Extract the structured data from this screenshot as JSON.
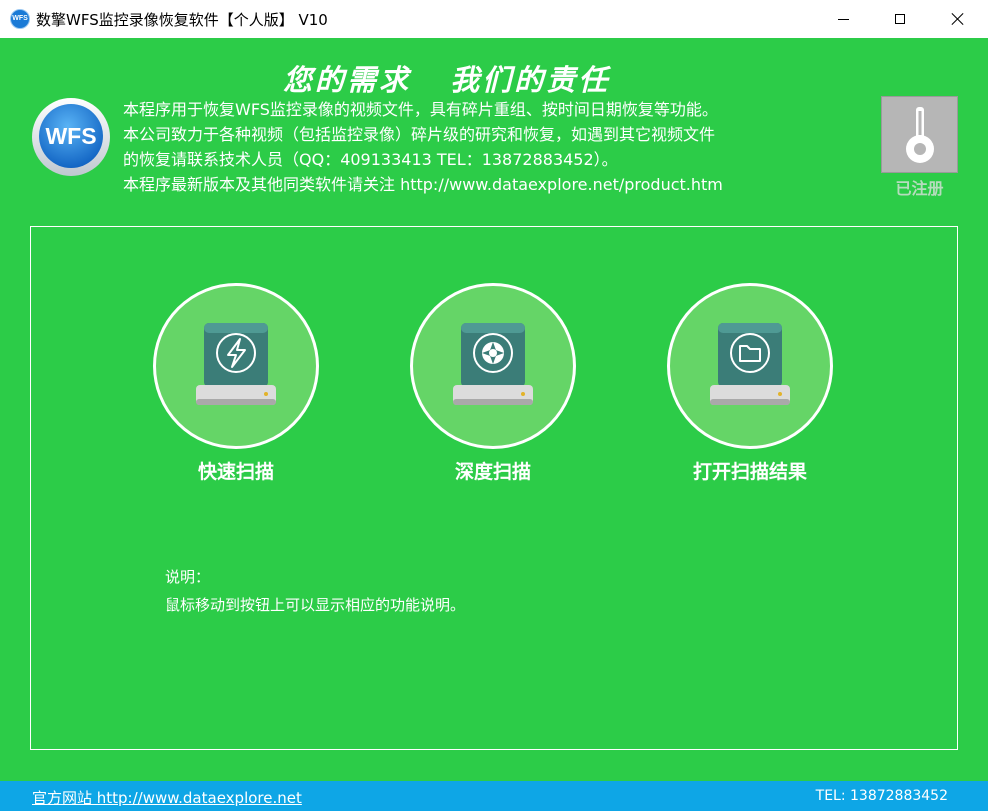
{
  "window": {
    "app_icon_text": "WFS",
    "title": "数擎WFS监控录像恢复软件【个人版】 V10"
  },
  "header": {
    "slogan": "您的需求   我们的责任",
    "logo_text": "WFS",
    "info_lines": [
      "本程序用于恢复WFS监控录像的视频文件，具有碎片重组、按时间日期恢复等功能。",
      "本公司致力于各种视频（包括监控录像）碎片级的研究和恢复，如遇到其它视频文件",
      "的恢复请联系技术人员（QQ：409133413  TEL：13872883452）。",
      "本程序最新版本及其他同类软件请关注 http://www.dataexplore.net/product.htm"
    ],
    "registered_label": "已注册"
  },
  "actions": {
    "quick_scan": "快速扫描",
    "deep_scan": "深度扫描",
    "open_results": "打开扫描结果"
  },
  "description": {
    "title": "说明：",
    "text": "鼠标移动到按钮上可以显示相应的功能说明。"
  },
  "footer": {
    "website": "官方网站 http://www.dataexplore.net",
    "tel": "TEL: 13872883452"
  },
  "colors": {
    "background": "#2ccc48",
    "footer": "#0ea6e6",
    "circle_fill": "#65d567"
  }
}
